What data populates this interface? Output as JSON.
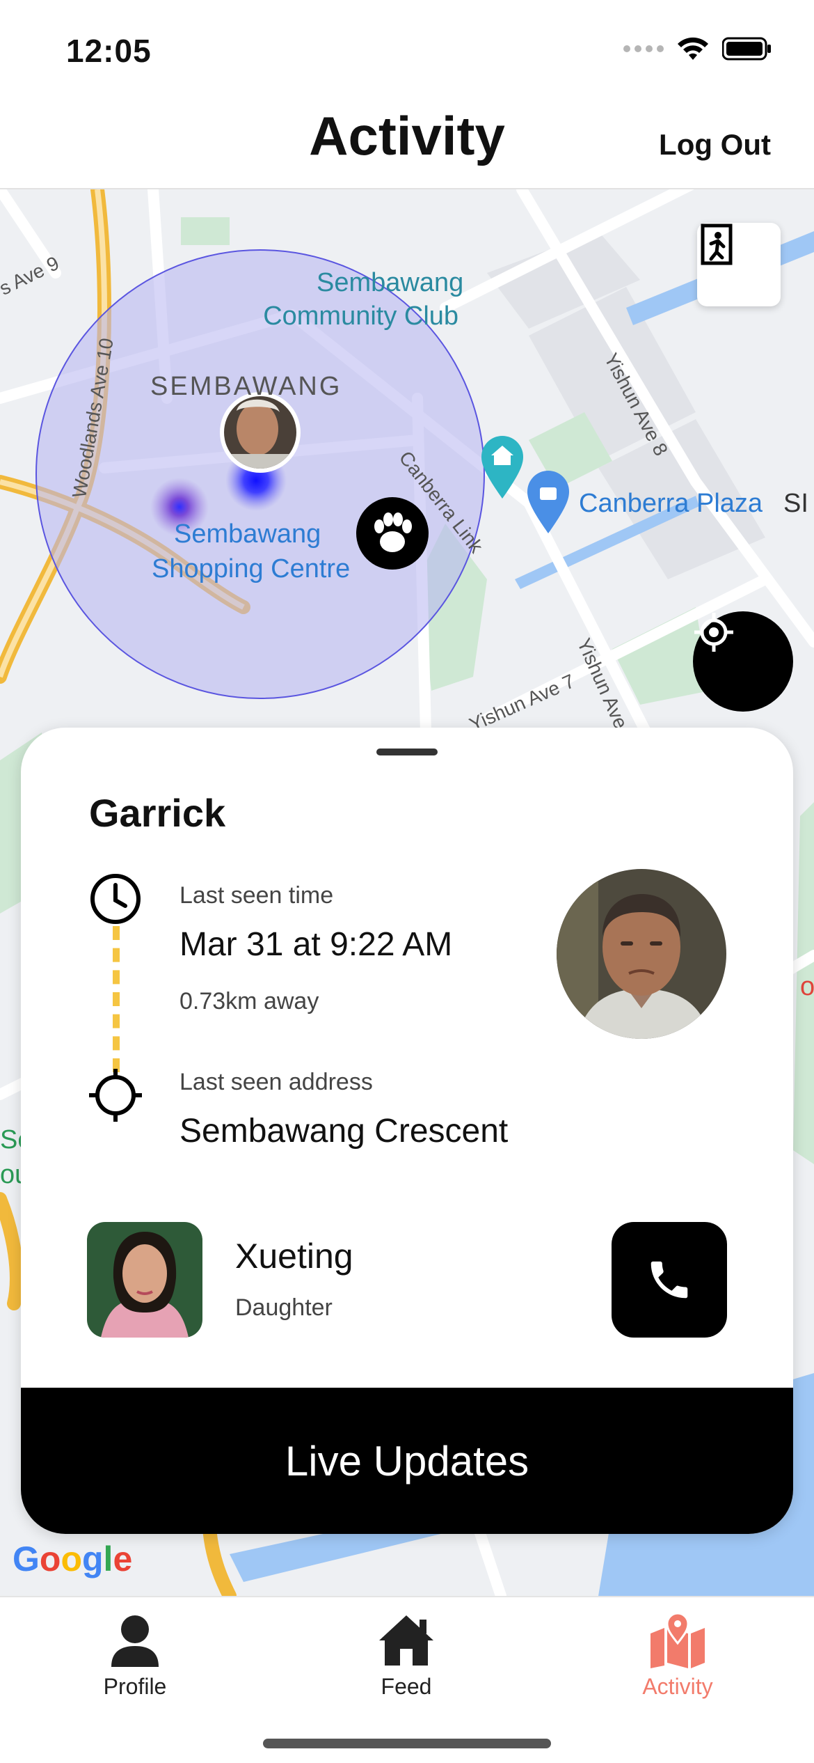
{
  "status_bar": {
    "time": "12:05"
  },
  "header": {
    "title": "Activity",
    "logout_label": "Log Out"
  },
  "map": {
    "labels": {
      "community_club": [
        "Sembawang",
        "Community Club"
      ],
      "area": "SEMBAWANG",
      "shopping_centre": [
        "Sembawang",
        "Shopping Centre"
      ],
      "canberra_plaza": "Canberra Plaza",
      "partial_si": "SI",
      "canberra_link": "Canberra Link",
      "woodlands_ave_10": "Woodlands Ave 10",
      "yishun_ave_8": "Yishun Ave 8",
      "yishun_ave_7": "Yishun Ave 7",
      "yishun_ave_partial": "Yishun Ave",
      "ave_9": "s Ave 9",
      "left_partial": [
        "Se",
        "ou"
      ],
      "right_partial": "o"
    },
    "google": "Google",
    "zone_color": "#b7b4f0",
    "accent_blue": "#2020e0"
  },
  "card": {
    "name": "Garrick",
    "last_seen_time_label": "Last seen time",
    "last_seen_time": "Mar 31 at 9:22 AM",
    "distance": "0.73km away",
    "last_seen_address_label": "Last seen address",
    "last_seen_address": "Sembawang Crescent",
    "contact": {
      "name": "Xueting",
      "relation": "Daughter"
    },
    "live_updates_label": "Live Updates"
  },
  "tabbar": {
    "items": [
      {
        "label": "Profile",
        "icon": "person-icon"
      },
      {
        "label": "Feed",
        "icon": "home-icon"
      },
      {
        "label": "Activity",
        "icon": "map-pin-icon",
        "active": true
      }
    ],
    "active_color": "#f27b6b"
  }
}
